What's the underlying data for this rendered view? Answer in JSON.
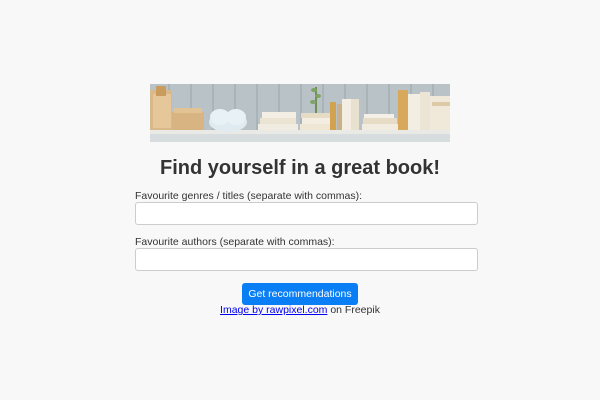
{
  "banner": {
    "icon": "bookshelf-image"
  },
  "heading": "Find yourself in a great book!",
  "form": {
    "genres_label": "Favourite genres / titles (separate with commas):",
    "genres_value": "",
    "authors_label": "Favourite authors (separate with commas):",
    "authors_value": "",
    "submit_label": "Get recommendations"
  },
  "credit": {
    "link_text": "Image by rawpixel.com",
    "suffix": " on Freepik"
  },
  "colors": {
    "background": "#f8f8f8",
    "accent": "#0a7ff5",
    "text": "#333333",
    "link": "#0000ee"
  }
}
